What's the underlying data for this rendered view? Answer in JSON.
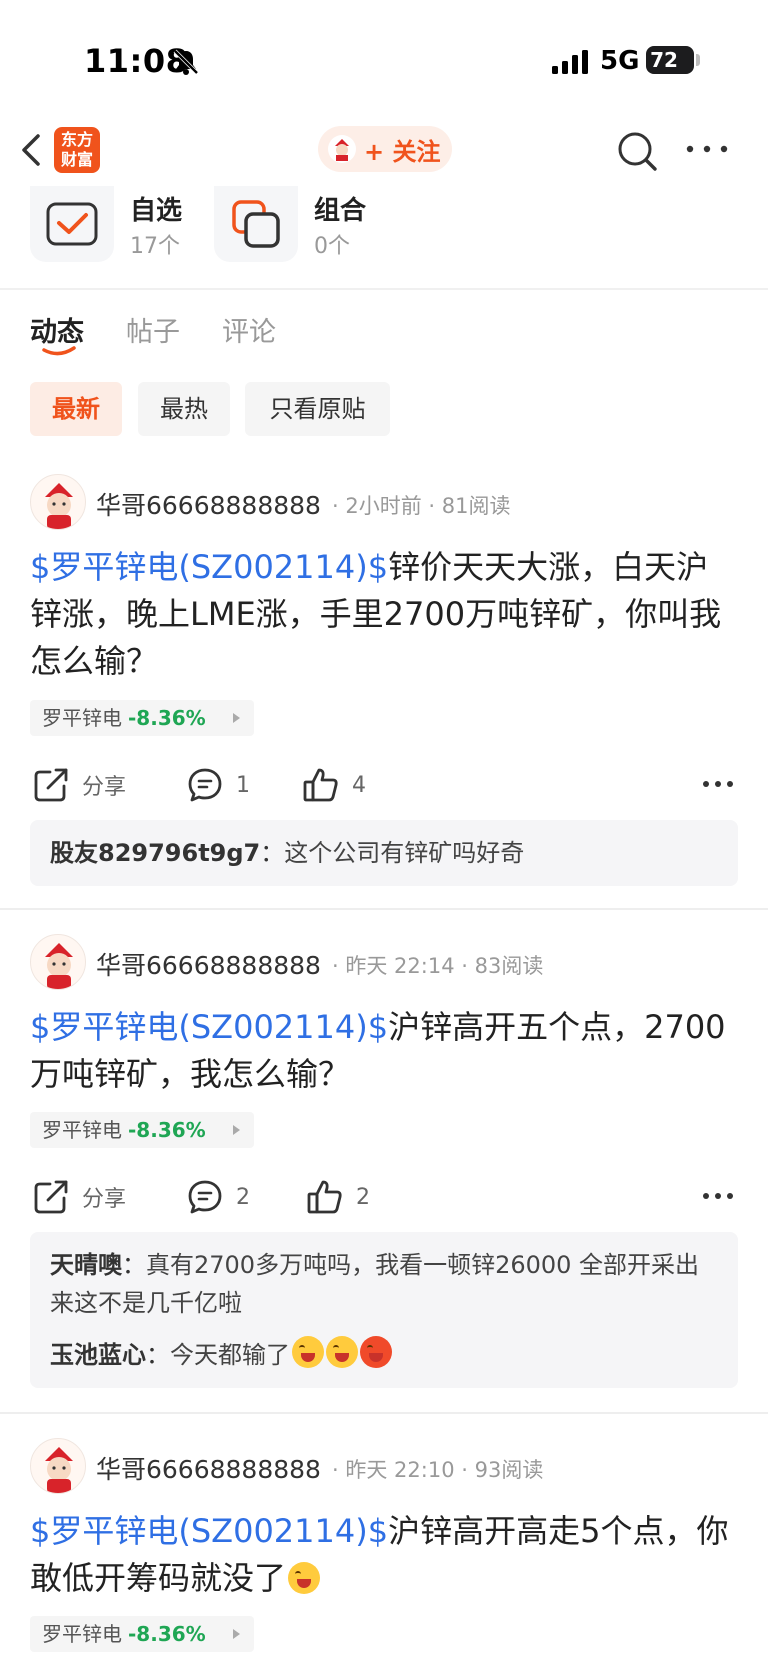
{
  "status_bar": {
    "time": "11:08",
    "network": "5G",
    "battery": "72"
  },
  "nav": {
    "logo_text": "东方财富",
    "follow_label": "+ 关注"
  },
  "cards": [
    {
      "title": "自选",
      "count": "17个"
    },
    {
      "title": "组合",
      "count": "0个"
    }
  ],
  "tabs": [
    "动态",
    "帖子",
    "评论"
  ],
  "filters": [
    "最新",
    "最热",
    "只看原贴"
  ],
  "posts": [
    {
      "author": "华哥66668888888",
      "time": "2小时前",
      "reads": "81阅读",
      "stock_link": "$罗平锌电(SZ002114)$",
      "text": "锌价天天大涨，白天沪锌涨，晚上LME涨，手里2700万吨锌矿，你叫我怎么输？",
      "tag_name": "罗平锌电",
      "tag_change": "-8.36%",
      "share_label": "分享",
      "comments": "1",
      "likes": "4",
      "replies": [
        {
          "user": "股友829796t9g7",
          "text": "这个公司有锌矿吗好奇"
        }
      ]
    },
    {
      "author": "华哥66668888888",
      "time": "昨天 22:14",
      "reads": "83阅读",
      "stock_link": "$罗平锌电(SZ002114)$",
      "text": "沪锌高开五个点，2700万吨锌矿，我怎么输？",
      "tag_name": "罗平锌电",
      "tag_change": "-8.36%",
      "share_label": "分享",
      "comments": "2",
      "likes": "2",
      "replies": [
        {
          "user": "天晴噢",
          "text": "真有2700多万吨吗，我看一顿锌26000 全部开采出来这不是几千亿啦"
        },
        {
          "user": "玉池蓝心",
          "text": "今天都输了"
        }
      ]
    },
    {
      "author": "华哥66668888888",
      "time": "昨天 22:10",
      "reads": "93阅读",
      "stock_link": "$罗平锌电(SZ002114)$",
      "text": "沪锌高开高走5个点，你敢低开筹码就没了",
      "tag_name": "罗平锌电",
      "tag_change": "-8.36%"
    }
  ],
  "colors": {
    "accent": "#f0531c",
    "link": "#2f6fe4",
    "down": "#1fa654"
  }
}
